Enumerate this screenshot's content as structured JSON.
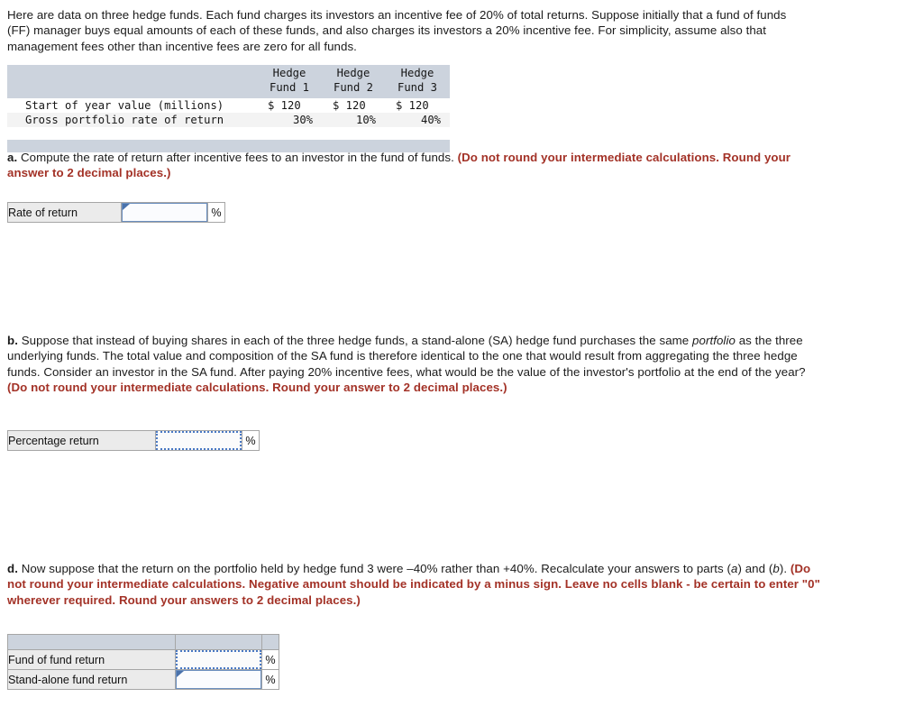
{
  "intro": {
    "paragraph": "Here are data on three hedge funds. Each fund charges its investors an incentive fee of 20% of total returns. Suppose initially that a fund of funds (FF) manager buys equal amounts of each of these funds, and also charges its investors a 20% incentive fee. For simplicity, assume also that management fees other than incentive fees are zero for all funds."
  },
  "data_table": {
    "col_headers": [
      {
        "line1": "Hedge",
        "line2": "Fund 1"
      },
      {
        "line1": "Hedge",
        "line2": "Fund 2"
      },
      {
        "line1": "Hedge",
        "line2": "Fund 3"
      }
    ],
    "rows": [
      {
        "label": "Start of year value (millions)",
        "values": [
          "$ 120",
          "$ 120",
          "$ 120"
        ]
      },
      {
        "label": "Gross portfolio rate of return",
        "values": [
          "30%",
          "10%",
          "40%"
        ]
      }
    ]
  },
  "part_a": {
    "letter": "a.",
    "text": " Compute the rate of return after incentive fees to an investor in the fund of funds. ",
    "requirement": "(Do not round your intermediate calculations. Round your answer to 2 decimal places.)",
    "answer_row": {
      "label": "Rate of return",
      "value": "",
      "unit": "%"
    }
  },
  "part_b": {
    "letter": "b.",
    "text_1": " Suppose that instead of buying shares in each of the three hedge funds, a stand-alone (SA) hedge fund purchases the same ",
    "italic_word": "portfolio",
    "text_2": " as the three underlying funds. The total value and composition of the SA fund is therefore identical to the one that would result from aggregating the three hedge funds. Consider an investor in the SA fund. After paying 20% incentive fees, what would be the value of the investor's portfolio at the end of the year? ",
    "requirement": "(Do not round your intermediate calculations. Round your answer to 2 decimal places.)",
    "answer_row": {
      "label": "Percentage return",
      "value": "",
      "unit": "%"
    }
  },
  "part_d": {
    "letter": "d.",
    "text_1": " Now suppose that the return on the portfolio held by hedge fund 3 were –40% rather than +40%. Recalculate your answers to parts (",
    "italic_a": "a",
    "text_2": ") and (",
    "italic_b": "b",
    "text_3": "). ",
    "requirement": "(Do not round your intermediate calculations. Negative amount should be indicated by a minus sign. Leave no cells blank - be certain to enter \"0\" wherever required. Round your answers to 2 decimal places.)",
    "answer_rows": [
      {
        "label": "Fund of fund return",
        "value": "",
        "unit": "%"
      },
      {
        "label": "Stand-alone fund return",
        "value": "",
        "unit": "%"
      }
    ]
  },
  "colors": {
    "table_header_band": "#ccd3dd",
    "requirement_red": "#a33227",
    "active_cell_border": "#6b8fbf",
    "dotted_cell_border": "#4a79c4",
    "label_cell_bg": "#ebebeb"
  }
}
